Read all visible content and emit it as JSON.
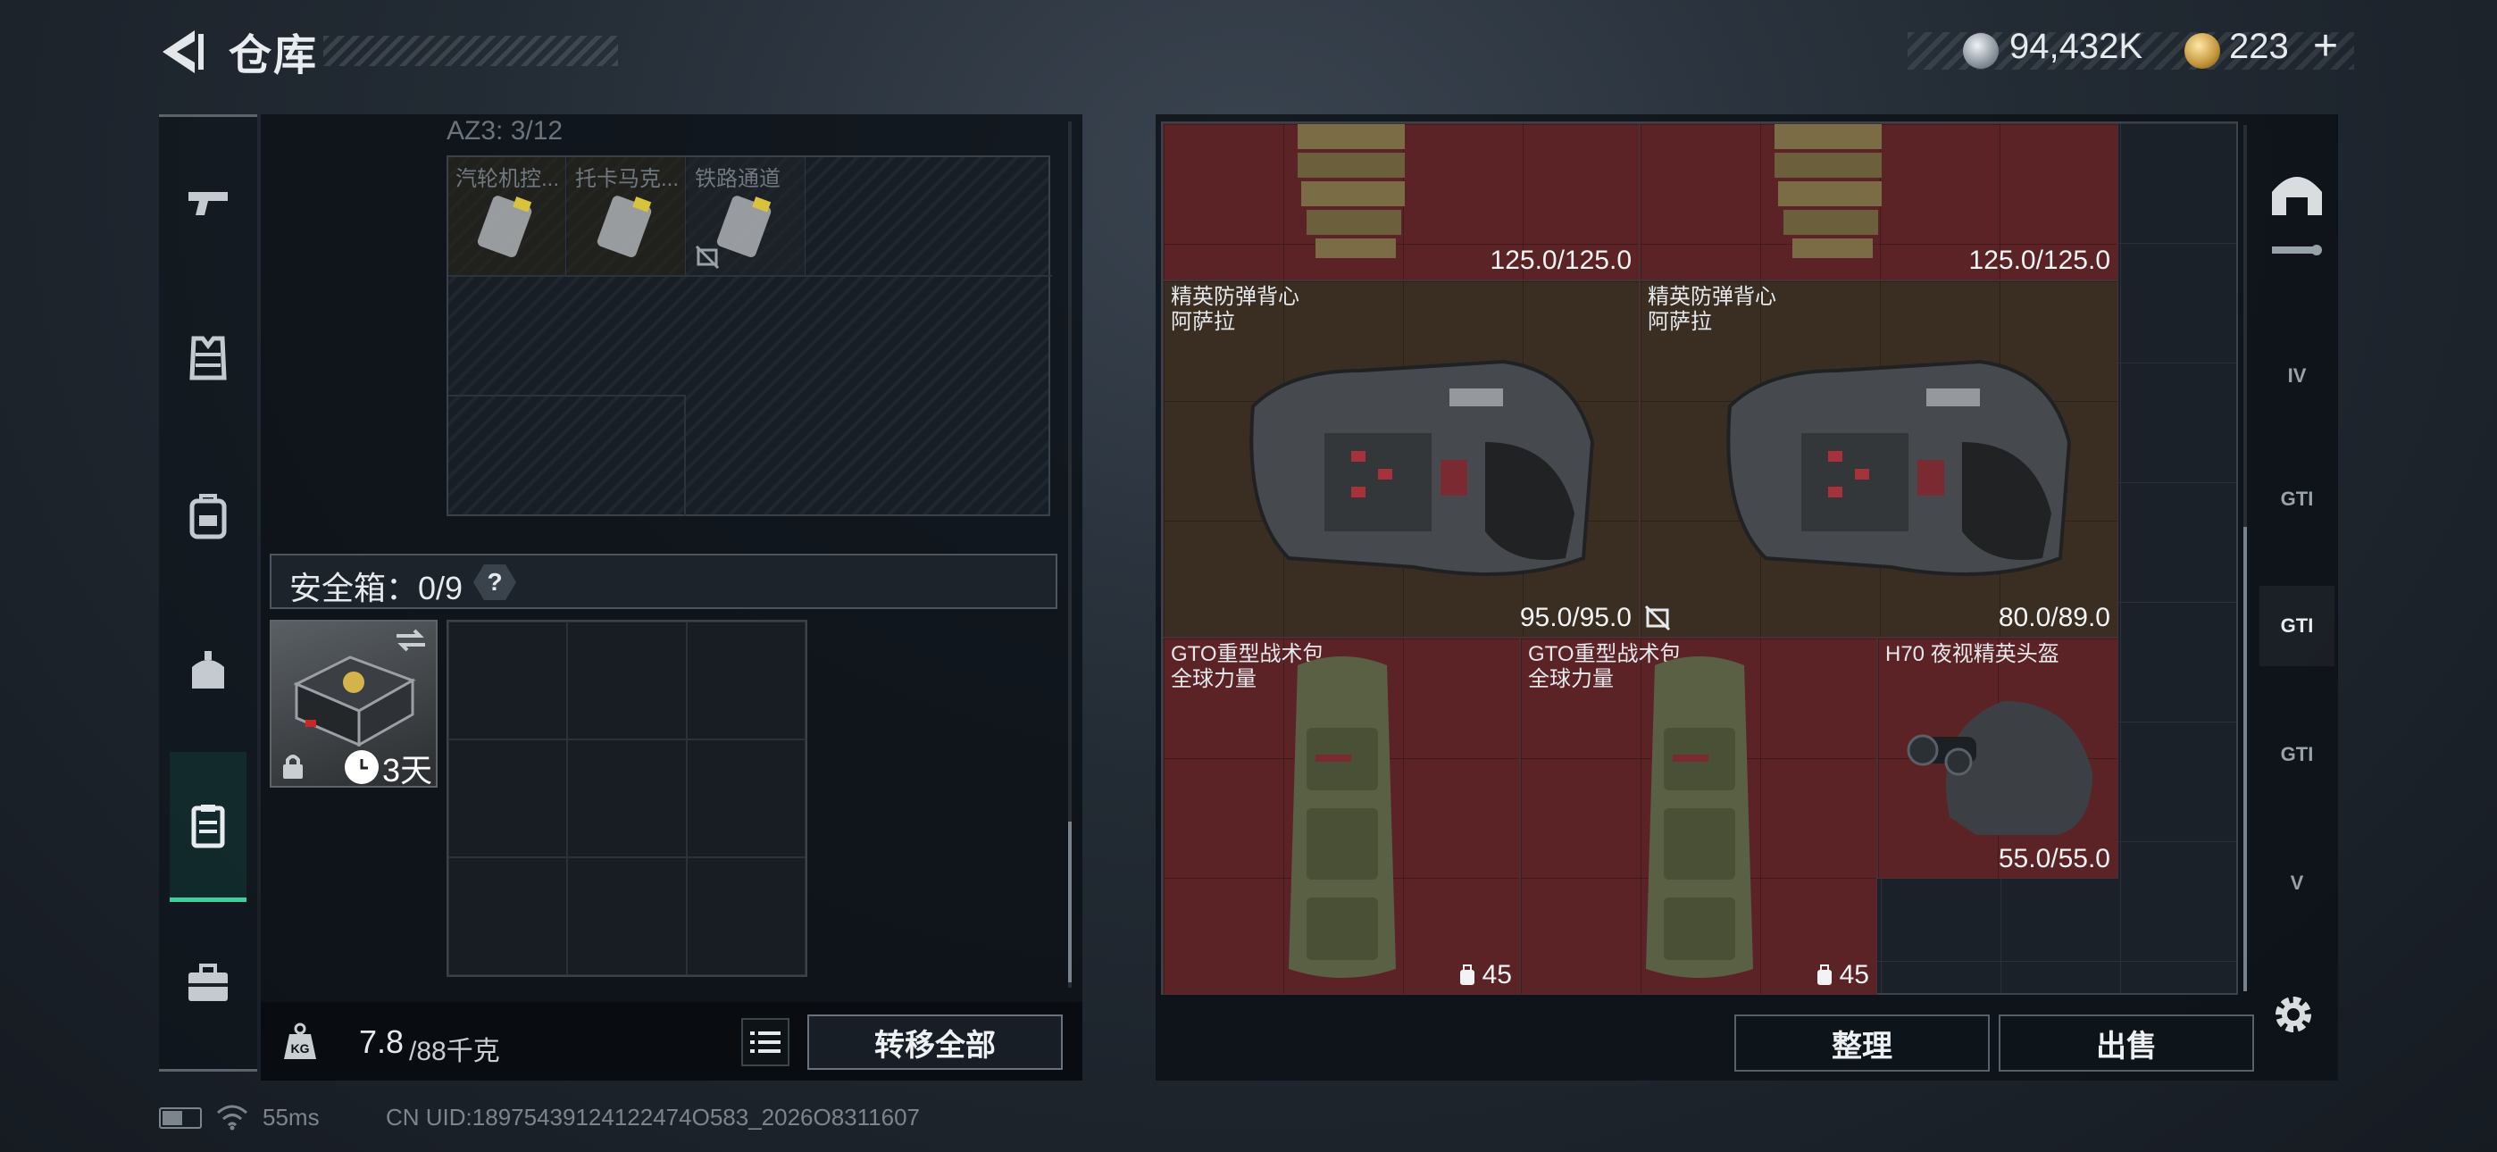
{
  "header": {
    "title": "仓库",
    "currency_1": "94,432K",
    "currency_2": "223",
    "add_symbol": "+"
  },
  "sidebar": {
    "items": [
      {
        "icon": "pistol-icon"
      },
      {
        "icon": "vest-icon"
      },
      {
        "icon": "backpack-icon"
      },
      {
        "icon": "pouch-icon"
      },
      {
        "icon": "safe-box-icon",
        "active": true
      },
      {
        "icon": "briefcase-icon"
      }
    ]
  },
  "az3": {
    "label": "AZ3: 3/12",
    "slots": [
      {
        "name": "汽轮机控..."
      },
      {
        "name": "托卡马克..."
      },
      {
        "name": "铁路通道"
      }
    ]
  },
  "safe_box": {
    "label": "安全箱：0/9",
    "help": "?",
    "case_days": "3天"
  },
  "weight": {
    "current": "7.8",
    "max": "/88千克"
  },
  "buttons": {
    "transfer_all": "转移全部",
    "sort": "整理",
    "sell": "出售"
  },
  "inventory": {
    "items": [
      {
        "name": "",
        "durability": "125.0/125.0"
      },
      {
        "name": "",
        "durability": "125.0/125.0"
      },
      {
        "name": "精英防弹背心\n阿萨拉",
        "durability": "95.0/95.0"
      },
      {
        "name": "精英防弹背心\n阿萨拉",
        "durability": "80.0/89.0"
      },
      {
        "name": "GTO重型战术包\n全球力量",
        "capacity": "45"
      },
      {
        "name": "GTO重型战术包\n全球力量",
        "capacity": "45"
      },
      {
        "name": "H70 夜视精英头盔",
        "durability": "55.0/55.0"
      }
    ]
  },
  "filters": [
    "IV",
    "GTI",
    "GTI",
    "GTI",
    "V"
  ],
  "status": {
    "ping": "55ms",
    "uid": "CN UID:18975439124122474O583_2026O8311607"
  }
}
